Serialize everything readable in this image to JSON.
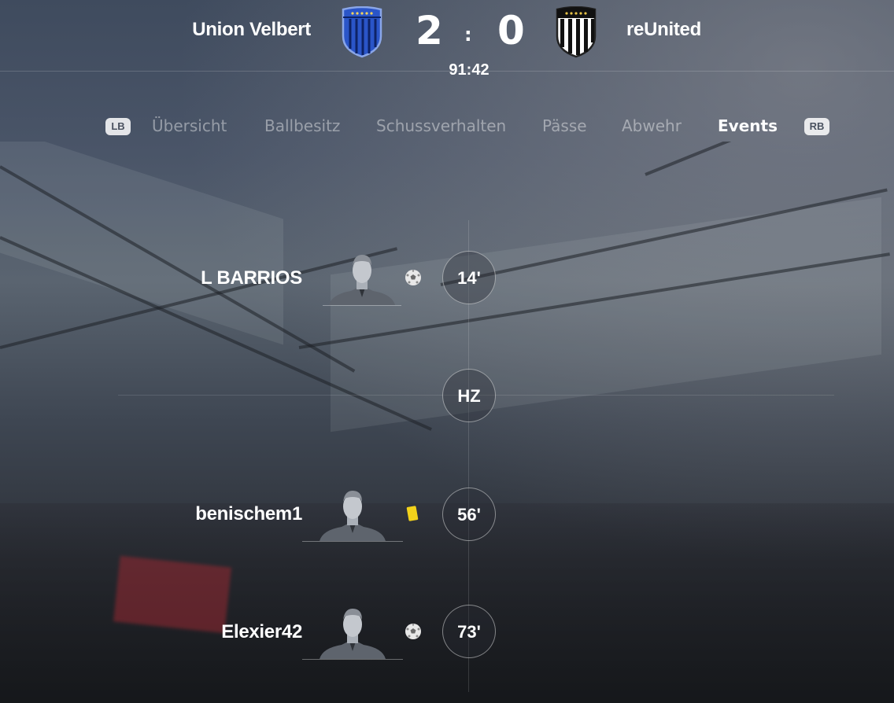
{
  "match": {
    "home_team": "Union Velbert",
    "away_team": "reUnited",
    "home_score": "2",
    "separator": ":",
    "away_score": "0",
    "clock": "91:42"
  },
  "tabs": {
    "left_bumper": "LB",
    "right_bumper": "RB",
    "items": [
      {
        "label": "Übersicht",
        "active": false
      },
      {
        "label": "Ballbesitz",
        "active": false
      },
      {
        "label": "Schussverhalten",
        "active": false
      },
      {
        "label": "Pässe",
        "active": false
      },
      {
        "label": "Abwehr",
        "active": false
      },
      {
        "label": "Events",
        "active": true
      }
    ]
  },
  "events": [
    {
      "player": "L BARRIOS",
      "type": "goal-icon",
      "minute": "14'"
    },
    {
      "marker": "HZ"
    },
    {
      "player": "benischem1",
      "type": "yellow-card-icon",
      "minute": "56'"
    },
    {
      "player": "Elexier42",
      "type": "goal-icon",
      "minute": "73'"
    }
  ],
  "colors": {
    "home_crest": "#2a55c8",
    "away_crest": "#111111",
    "yellow_card": "#f2d21b"
  }
}
